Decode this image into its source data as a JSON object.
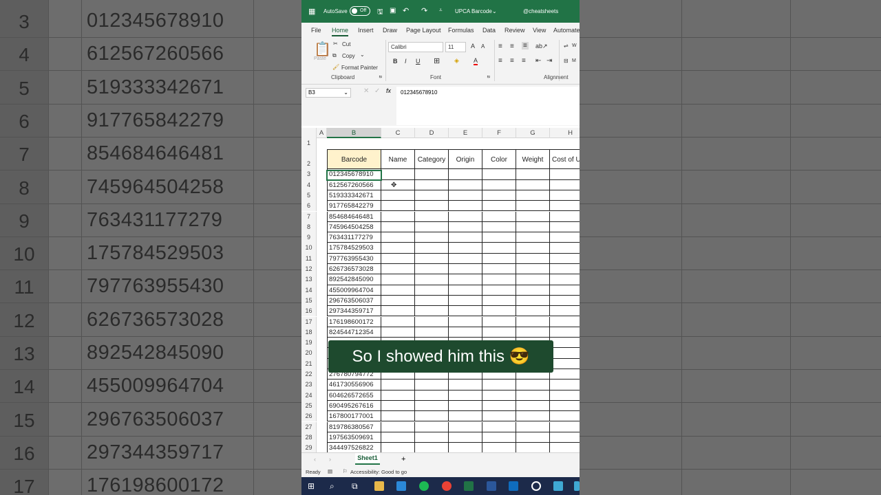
{
  "background": {
    "row_numbers": [
      "3",
      "4",
      "5",
      "6",
      "7",
      "8",
      "9",
      "10",
      "11",
      "12",
      "13",
      "14",
      "15",
      "16",
      "17"
    ],
    "values": [
      "012345678910",
      "612567260566",
      "519333342671",
      "917765842279",
      "854684646481",
      "745964504258",
      "763431177279",
      "175784529503",
      "797763955430",
      "626736573028",
      "892542845090",
      "455009964704",
      "296763506037",
      "297344359717",
      "176198600172"
    ]
  },
  "titlebar": {
    "autosave_label": "AutoSave",
    "toggle_state": "Off",
    "file_name": "UPCA Barcode",
    "watermark": "@cheatsheets"
  },
  "ribbon_tabs": [
    "File",
    "Home",
    "Insert",
    "Draw",
    "Page Layout",
    "Formulas",
    "Data",
    "Review",
    "View",
    "Automate"
  ],
  "ribbon": {
    "paste": "Paste",
    "cut": "Cut",
    "copy": "Copy",
    "format_painter": "Format Painter",
    "clipboard_label": "Clipboard",
    "font_name": "Calibri",
    "font_size": "11",
    "font_label": "Font",
    "alignment_label": "Alignment",
    "bold": "B",
    "italic": "I",
    "underline": "U",
    "wrap_stub": "W",
    "merge_stub": "M"
  },
  "formula_bar": {
    "name_box": "B3",
    "fx": "fx",
    "content": "012345678910"
  },
  "columns": [
    "A",
    "B",
    "C",
    "D",
    "E",
    "F",
    "G",
    "H"
  ],
  "header_row": [
    "Barcode",
    "Name",
    "Category",
    "Origin",
    "Color",
    "Weight",
    "Cost of U"
  ],
  "rows": [
    {
      "n": "1",
      "v": ""
    },
    {
      "n": "2",
      "v": ""
    },
    {
      "n": "3",
      "v": "012345678910"
    },
    {
      "n": "4",
      "v": "612567260566"
    },
    {
      "n": "5",
      "v": "519333342671"
    },
    {
      "n": "6",
      "v": "917765842279"
    },
    {
      "n": "7",
      "v": "854684646481"
    },
    {
      "n": "8",
      "v": "745964504258"
    },
    {
      "n": "9",
      "v": "763431177279"
    },
    {
      "n": "10",
      "v": "175784529503"
    },
    {
      "n": "11",
      "v": "797763955430"
    },
    {
      "n": "12",
      "v": "626736573028"
    },
    {
      "n": "13",
      "v": "892542845090"
    },
    {
      "n": "14",
      "v": "455009964704"
    },
    {
      "n": "15",
      "v": "296763506037"
    },
    {
      "n": "16",
      "v": "297344359717"
    },
    {
      "n": "17",
      "v": "176198600172"
    },
    {
      "n": "18",
      "v": "824544712354"
    },
    {
      "n": "19",
      "v": ""
    },
    {
      "n": "20",
      "v": ""
    },
    {
      "n": "21",
      "v": ""
    },
    {
      "n": "22",
      "v": "276780794772"
    },
    {
      "n": "23",
      "v": "461730556906"
    },
    {
      "n": "24",
      "v": "604626572655"
    },
    {
      "n": "25",
      "v": "690495267616"
    },
    {
      "n": "26",
      "v": "167800177001"
    },
    {
      "n": "27",
      "v": "819786380567"
    },
    {
      "n": "28",
      "v": "197563509691"
    },
    {
      "n": "29",
      "v": "344497526822"
    }
  ],
  "caption": "So I showed him this 😎",
  "sheet_tab": "Sheet1",
  "add_sheet": "+",
  "status": {
    "ready": "Ready",
    "accessibility": "Accessibility: Good to go"
  },
  "colors": {
    "excel_green": "#217346",
    "caption_bg": "#1e4a2e"
  }
}
